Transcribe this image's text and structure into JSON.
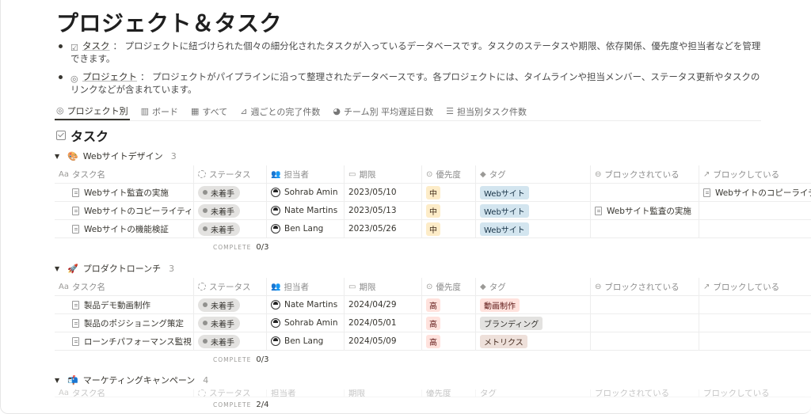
{
  "page": {
    "title": "プロジェクト＆タスク"
  },
  "description": {
    "items": [
      {
        "link": "タスク",
        "text": "： プロジェクトに紐づけられた個々の細分化されたタスクが入っているデータベースです。タスクのステータスや期限、依存関係、優先度や担当者などを管理できます。"
      },
      {
        "link": "プロジェクト",
        "text": "： プロジェクトがパイプラインに沿って整理されたデータベースです。各プロジェクトには、タイムラインや担当メンバー、ステータス更新やタスクのリンクなどが含まれています。"
      }
    ]
  },
  "tabs": [
    {
      "label": "プロジェクト別",
      "icon": "target-icon"
    },
    {
      "label": "ボード",
      "icon": "board-icon"
    },
    {
      "label": "すべて",
      "icon": "table-icon"
    },
    {
      "label": "週ごとの完了件数",
      "icon": "chart-line-icon"
    },
    {
      "label": "チーム別 平均遅延日数",
      "icon": "pie-icon"
    },
    {
      "label": "担当別タスク件数",
      "icon": "bar-icon"
    }
  ],
  "database": {
    "title": "タスク"
  },
  "columns": {
    "name": "タスク名",
    "status": "ステータス",
    "assignee": "担当者",
    "due": "期限",
    "priority": "優先度",
    "tag": "タグ",
    "blocked_by": "ブロックされている",
    "blocking": "ブロックしている"
  },
  "footer_label": "COMPLETE",
  "groups": [
    {
      "emoji": "🎨",
      "name": "Webサイトデザイン",
      "count": "3",
      "complete": "0/3",
      "rows": [
        {
          "name": "Webサイト監査の実施",
          "status": "未着手",
          "assignee": "Sohrab Amin",
          "due": "2023/05/10",
          "priority": "中",
          "tag": "Webサイト",
          "blocked_by": "",
          "blocking": "Webサイトのコピーライティング"
        },
        {
          "name": "Webサイトのコピーライティング",
          "status": "未着手",
          "assignee": "Nate Martins",
          "due": "2023/05/13",
          "priority": "中",
          "tag": "Webサイト",
          "blocked_by": "Webサイト監査の実施",
          "blocking": ""
        },
        {
          "name": "Webサイトの機能検証",
          "status": "未着手",
          "assignee": "Ben Lang",
          "due": "2023/05/26",
          "priority": "中",
          "tag": "Webサイト",
          "blocked_by": "",
          "blocking": ""
        }
      ]
    },
    {
      "emoji": "🚀",
      "name": "プロダクトローンチ",
      "count": "3",
      "complete": "0/3",
      "rows": [
        {
          "name": "製品デモ動画制作",
          "status": "未着手",
          "assignee": "Nate Martins",
          "due": "2024/04/29",
          "priority": "高",
          "tag": "動画制作",
          "blocked_by": "",
          "blocking": ""
        },
        {
          "name": "製品のポジショニング策定",
          "status": "未着手",
          "assignee": "Sohrab Amin",
          "due": "2024/05/01",
          "priority": "高",
          "tag": "ブランディング",
          "blocked_by": "",
          "blocking": ""
        },
        {
          "name": "ローンチパフォーマンス監視",
          "status": "未着手",
          "assignee": "Ben Lang",
          "due": "2024/05/09",
          "priority": "高",
          "tag": "メトリクス",
          "blocked_by": "",
          "blocking": ""
        }
      ]
    },
    {
      "emoji": "📬",
      "name": "マーケティングキャンペーン",
      "count": "4",
      "complete": "2/4",
      "rows": []
    }
  ]
}
